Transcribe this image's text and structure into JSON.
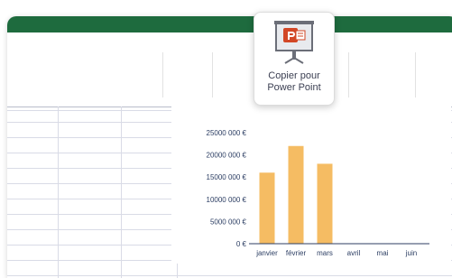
{
  "toolbar": {
    "copy_button": {
      "line1": "Copier pour",
      "line2": "Power Point",
      "icon": "powerpoint-icon"
    }
  },
  "colors": {
    "topbar": "#1e6b3e",
    "bar": "#f5bc63",
    "axis": "#2c3e63",
    "grid": "#d9dbe6"
  },
  "chart_data": {
    "type": "bar",
    "categories": [
      "janvier",
      "février",
      "mars",
      "avril",
      "mai",
      "juin"
    ],
    "values": [
      16000000,
      22000000,
      18000000,
      0,
      0,
      0
    ],
    "ylim": [
      0,
      25000000
    ],
    "yticks": [
      0,
      5000000,
      10000000,
      15000000,
      20000000,
      25000000
    ],
    "ytick_labels": [
      "0 €",
      "5000 000 €",
      "10000 000 €",
      "15000 000 €",
      "20000 000 €",
      "25000 000 €"
    ],
    "grid": false
  }
}
